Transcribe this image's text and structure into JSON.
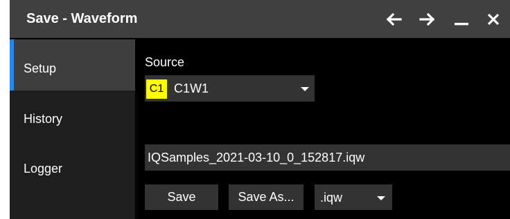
{
  "window": {
    "title": "Save - Waveform",
    "controls": [
      "arrow-left-icon",
      "arrow-right-icon",
      "minimize-icon",
      "close-icon"
    ]
  },
  "sidebar": {
    "items": [
      {
        "label": "Setup",
        "active": true
      },
      {
        "label": "History",
        "active": false
      },
      {
        "label": "Logger",
        "active": false
      }
    ]
  },
  "main": {
    "source_label": "Source",
    "source": {
      "badge": "C1",
      "badge_color": "#ffff00",
      "value": "C1W1"
    },
    "filename": "IQSamples_2021-03-10_0_152817.iqw",
    "save_label": "Save",
    "save_as_label": "Save As...",
    "extension": ".iqw"
  },
  "colors": {
    "title_bar": "#404040",
    "active_accent": "#1e88ff",
    "control_bg": "#333333"
  }
}
